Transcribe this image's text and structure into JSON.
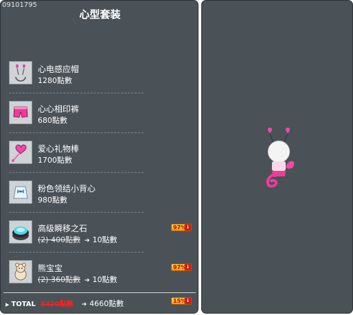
{
  "header": {
    "code": "09101795",
    "title": "心型套装"
  },
  "items": [
    {
      "name": "心电感应帽",
      "price": "1280點數",
      "icon": "heart-antenna-hat-icon"
    },
    {
      "name": "心心相印裤",
      "price": "680點數",
      "icon": "pink-shorts-icon"
    },
    {
      "name": "爱心礼物棒",
      "price": "1700點數",
      "icon": "heart-wand-icon"
    },
    {
      "name": "粉色领结小背心",
      "price": "980點數",
      "icon": "bow-vest-icon"
    },
    {
      "name": "高级瞬移之石",
      "old_price": "(2) 400點數",
      "new_price": "10點數",
      "discount": "97%",
      "icon": "teleport-stone-icon"
    },
    {
      "name": "熊宝宝",
      "old_price": "(2) 360點數",
      "new_price": "10點數",
      "discount": "97%",
      "icon": "baby-bear-icon"
    }
  ],
  "total": {
    "label": "TOTAL",
    "old": "5420點數",
    "new": "4660點數",
    "discount": "15%"
  },
  "colors": {
    "panel": "#4a5258",
    "discount_badge": "#ffc21a",
    "strike_red": "#ff1f1f"
  }
}
